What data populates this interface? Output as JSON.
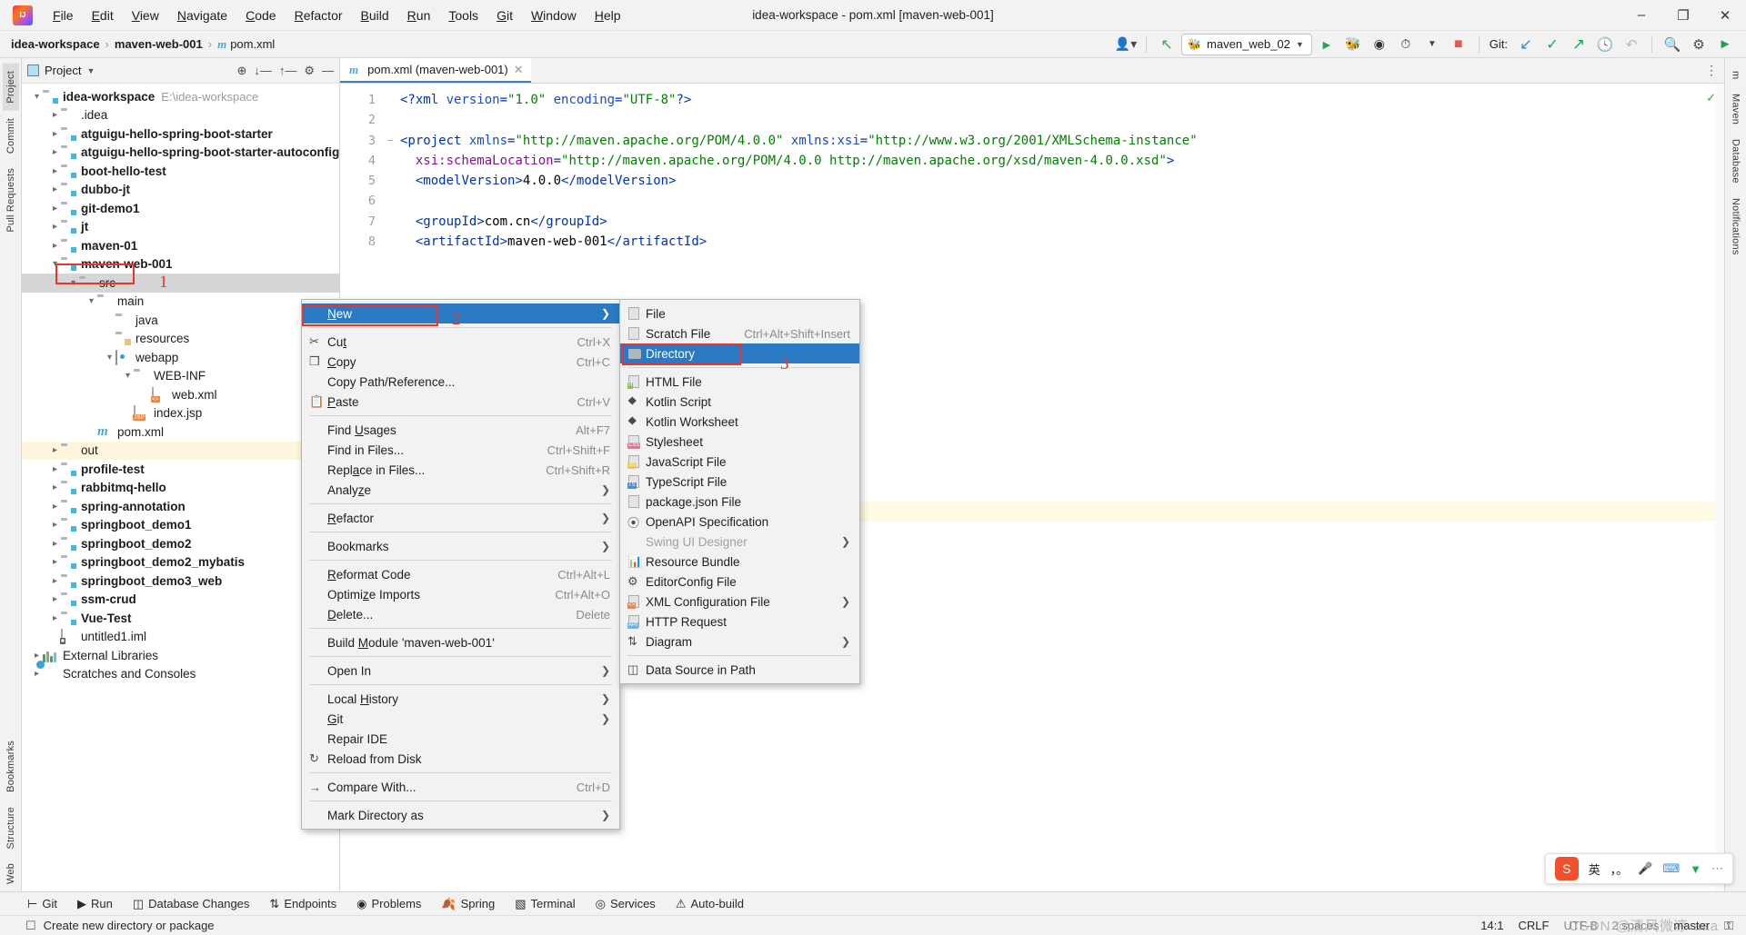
{
  "window": {
    "title": "idea-workspace - pom.xml [maven-web-001]",
    "logo_icon": "intellij-idea-logo",
    "controls": {
      "minimize": "–",
      "maximize": "❐",
      "close": "✕"
    }
  },
  "menubar": [
    {
      "label": "File",
      "mnemonic": "F"
    },
    {
      "label": "Edit",
      "mnemonic": "E"
    },
    {
      "label": "View",
      "mnemonic": "V"
    },
    {
      "label": "Navigate",
      "mnemonic": "N"
    },
    {
      "label": "Code",
      "mnemonic": "C"
    },
    {
      "label": "Refactor",
      "mnemonic": "R"
    },
    {
      "label": "Build",
      "mnemonic": "B"
    },
    {
      "label": "Run",
      "mnemonic": "R"
    },
    {
      "label": "Tools",
      "mnemonic": "T"
    },
    {
      "label": "Git",
      "mnemonic": "G"
    },
    {
      "label": "Window",
      "mnemonic": "W"
    },
    {
      "label": "Help",
      "mnemonic": "H"
    }
  ],
  "navbar": {
    "crumbs": [
      {
        "label": "idea-workspace",
        "bold": true
      },
      {
        "label": "maven-web-001",
        "bold": true
      },
      {
        "label": "pom.xml",
        "bold": false,
        "icon": "maven-m-icon"
      }
    ],
    "separator": "›",
    "run_config": {
      "name": "maven_web_02",
      "icon": "maven-bee-icon",
      "chevron": "▼"
    },
    "buttons": [
      {
        "name": "user-settings-icon",
        "glyph": "▼"
      },
      {
        "name": "build-hammer-icon",
        "glyph": "↖"
      },
      {
        "name": "run-icon",
        "glyph": "▶"
      },
      {
        "name": "debug-icon",
        "glyph": "⚙"
      },
      {
        "name": "run-with-coverage-icon",
        "glyph": "▷"
      },
      {
        "name": "profiler-icon",
        "glyph": "◴"
      },
      {
        "name": "stop-icon",
        "glyph": "■"
      }
    ],
    "git_label": "Git:",
    "git_buttons": [
      {
        "name": "git-update-project-icon",
        "glyph": "↙"
      },
      {
        "name": "git-commit-icon",
        "glyph": "✓"
      },
      {
        "name": "git-push-icon",
        "glyph": "↗"
      },
      {
        "name": "git-history-icon",
        "glyph": "◷"
      },
      {
        "name": "git-rollback-icon",
        "glyph": "↶"
      }
    ],
    "right_buttons": [
      {
        "name": "search-everywhere-icon",
        "glyph": "⚲"
      },
      {
        "name": "settings-gear-icon",
        "glyph": "⚙"
      },
      {
        "name": "ide-assistant-icon",
        "glyph": "▶"
      }
    ]
  },
  "left_strip": [
    {
      "label": "Project",
      "selected": true
    },
    {
      "label": "Commit",
      "selected": false
    },
    {
      "label": "Pull Requests",
      "selected": false
    },
    {
      "label": "Bookmarks",
      "selected": false
    },
    {
      "label": "Structure",
      "selected": false
    },
    {
      "label": "Web",
      "selected": false
    }
  ],
  "right_strip": [
    {
      "label": "m"
    },
    {
      "label": "Maven"
    },
    {
      "label": "Database"
    },
    {
      "label": "Notifications"
    }
  ],
  "project_panel": {
    "title": "Project",
    "chevron": "▼",
    "toolbar_icons": [
      {
        "name": "select-opened-file-icon",
        "glyph": "⊕"
      },
      {
        "name": "expand-all-icon",
        "glyph": "⤓"
      },
      {
        "name": "collapse-all-icon",
        "glyph": "⤒"
      },
      {
        "name": "settings-gear-icon",
        "glyph": "⚙"
      },
      {
        "name": "hide-icon",
        "glyph": "—"
      }
    ],
    "tree": [
      {
        "depth": 0,
        "arrow": "down",
        "icon": "module-folder",
        "label": "idea-workspace",
        "bold": true,
        "path": "E:\\idea-workspace"
      },
      {
        "depth": 1,
        "arrow": "right",
        "icon": "folder",
        "label": ".idea",
        "bold": false
      },
      {
        "depth": 1,
        "arrow": "right",
        "icon": "module-folder",
        "label": "atguigu-hello-spring-boot-starter",
        "bold": true
      },
      {
        "depth": 1,
        "arrow": "right",
        "icon": "module-folder",
        "label": "atguigu-hello-spring-boot-starter-autoconfigu",
        "bold": true
      },
      {
        "depth": 1,
        "arrow": "right",
        "icon": "module-folder",
        "label": "boot-hello-test",
        "bold": true
      },
      {
        "depth": 1,
        "arrow": "right",
        "icon": "module-folder",
        "label": "dubbo-jt",
        "bold": true
      },
      {
        "depth": 1,
        "arrow": "right",
        "icon": "module-folder",
        "label": "git-demo1",
        "bold": true
      },
      {
        "depth": 1,
        "arrow": "right",
        "icon": "module-folder",
        "label": "jt",
        "bold": true
      },
      {
        "depth": 1,
        "arrow": "right",
        "icon": "module-folder",
        "label": "maven-01",
        "bold": true
      },
      {
        "depth": 1,
        "arrow": "down",
        "icon": "module-folder",
        "label": "maven-web-001",
        "bold": true
      },
      {
        "depth": 2,
        "arrow": "down",
        "icon": "folder",
        "label": "src",
        "bold": false,
        "selected": true
      },
      {
        "depth": 3,
        "arrow": "down",
        "icon": "folder",
        "label": "main",
        "bold": false
      },
      {
        "depth": 4,
        "arrow": "none",
        "icon": "source-folder",
        "label": "java",
        "bold": false
      },
      {
        "depth": 4,
        "arrow": "none",
        "icon": "resource-folder",
        "label": "resources",
        "bold": false
      },
      {
        "depth": 4,
        "arrow": "down",
        "icon": "web-folder",
        "label": "webapp",
        "bold": false
      },
      {
        "depth": 5,
        "arrow": "down",
        "icon": "folder",
        "label": "WEB-INF",
        "bold": false
      },
      {
        "depth": 6,
        "arrow": "none",
        "icon": "xml-file",
        "label": "web.xml",
        "bold": false
      },
      {
        "depth": 5,
        "arrow": "none",
        "icon": "jsp-file",
        "label": "index.jsp",
        "bold": false
      },
      {
        "depth": 3,
        "arrow": "none",
        "icon": "maven-file",
        "label": "pom.xml",
        "bold": false
      },
      {
        "depth": 1,
        "arrow": "right",
        "icon": "out-folder",
        "label": "out",
        "bold": false,
        "highlight": true
      },
      {
        "depth": 1,
        "arrow": "right",
        "icon": "module-folder",
        "label": "profile-test",
        "bold": true
      },
      {
        "depth": 1,
        "arrow": "right",
        "icon": "module-folder",
        "label": "rabbitmq-hello",
        "bold": true
      },
      {
        "depth": 1,
        "arrow": "right",
        "icon": "module-folder",
        "label": "spring-annotation",
        "bold": true
      },
      {
        "depth": 1,
        "arrow": "right",
        "icon": "module-folder",
        "label": "springboot_demo1",
        "bold": true
      },
      {
        "depth": 1,
        "arrow": "right",
        "icon": "module-folder",
        "label": "springboot_demo2",
        "bold": true
      },
      {
        "depth": 1,
        "arrow": "right",
        "icon": "module-folder",
        "label": "springboot_demo2_mybatis",
        "bold": true
      },
      {
        "depth": 1,
        "arrow": "right",
        "icon": "module-folder",
        "label": "springboot_demo3_web",
        "bold": true
      },
      {
        "depth": 1,
        "arrow": "right",
        "icon": "module-folder",
        "label": "ssm-crud",
        "bold": true
      },
      {
        "depth": 1,
        "arrow": "right",
        "icon": "module-folder",
        "label": "Vue-Test",
        "bold": true
      },
      {
        "depth": 1,
        "arrow": "none",
        "icon": "iml-file",
        "label": "untitled1.iml",
        "bold": false
      },
      {
        "depth": 0,
        "arrow": "right",
        "icon": "libraries",
        "label": "External Libraries",
        "bold": false
      },
      {
        "depth": 0,
        "arrow": "right",
        "icon": "scratches",
        "label": "Scratches and Consoles",
        "bold": false
      }
    ]
  },
  "editor": {
    "tab": {
      "label": "pom.xml (maven-web-001)",
      "icon": "maven-m-icon",
      "close": "✕"
    },
    "more_icon": "⋮",
    "inspection_status": "✓",
    "lines": [
      {
        "n": 1,
        "fold": "",
        "html": "<span class=\"cx-tag\">&lt;?xml </span><span class=\"cx-attr\">version</span><span class=\"cx-tag\">=</span><span class=\"cx-val\">\"1.0\"</span><span class=\"cx-attr\"> encoding</span><span class=\"cx-tag\">=</span><span class=\"cx-val\">\"UTF-8\"</span><span class=\"cx-tag\">?&gt;</span>"
      },
      {
        "n": 2,
        "fold": "",
        "html": ""
      },
      {
        "n": 3,
        "fold": "−",
        "html": "<span class=\"cx-tag\">&lt;project </span><span class=\"cx-attr\">xmlns</span><span class=\"cx-tag\">=</span><span class=\"cx-val\">\"http://maven.apache.org/POM/4.0.0\"</span><span class=\"cx-attr\"> xmlns:xsi</span><span class=\"cx-tag\">=</span><span class=\"cx-val\">\"http://www.w3.org/2001/XMLSchema-instance\"</span>"
      },
      {
        "n": 4,
        "fold": "",
        "html": "  <span class=\"cx-ns\">xsi:schemaLocation</span><span class=\"cx-tag\">=</span><span class=\"cx-val\">\"http://maven.apache.org/POM/4.0.0 http://maven.apache.org/xsd/maven-4.0.0.xsd\"</span><span class=\"cx-tag\">&gt;</span>"
      },
      {
        "n": 5,
        "fold": "",
        "html": "  <span class=\"cx-tag\">&lt;</span><span class=\"cx-name\">modelVersion</span><span class=\"cx-tag\">&gt;</span><span class=\"cx-txt\">4.0.0</span><span class=\"cx-tag\">&lt;/</span><span class=\"cx-name\">modelVersion</span><span class=\"cx-tag\">&gt;</span>"
      },
      {
        "n": 6,
        "fold": "",
        "html": ""
      },
      {
        "n": 7,
        "fold": "",
        "html": "  <span class=\"cx-tag\">&lt;</span><span class=\"cx-name\">groupId</span><span class=\"cx-tag\">&gt;</span><span class=\"cx-txt\">com.cn</span><span class=\"cx-tag\">&lt;/</span><span class=\"cx-name\">groupId</span><span class=\"cx-tag\">&gt;</span>"
      },
      {
        "n": 8,
        "fold": "",
        "html": "  <span class=\"cx-tag\">&lt;</span><span class=\"cx-name\">artifactId</span><span class=\"cx-tag\">&gt;</span><span class=\"cx-txt\">maven-web-001</span><span class=\"cx-tag\">&lt;/</span><span class=\"cx-name\">artifactId</span><span class=\"cx-tag\">&gt;</span>"
      }
    ]
  },
  "context_menu": {
    "items": [
      {
        "label": "New",
        "mnem": "N",
        "selected": true,
        "submenu": true,
        "annotated": true
      },
      {
        "sep": true
      },
      {
        "label": "Cut",
        "mnem": "t",
        "shortcut": "Ctrl+X",
        "icon": "scissors-icon"
      },
      {
        "label": "Copy",
        "mnem": "C",
        "shortcut": "Ctrl+C",
        "icon": "copy-icon"
      },
      {
        "label": "Copy Path/Reference...",
        "shortcut": ""
      },
      {
        "label": "Paste",
        "mnem": "P",
        "shortcut": "Ctrl+V",
        "icon": "paste-icon"
      },
      {
        "sep": true
      },
      {
        "label": "Find Usages",
        "mnem": "U",
        "shortcut": "Alt+F7"
      },
      {
        "label": "Find in Files...",
        "shortcut": "Ctrl+Shift+F"
      },
      {
        "label": "Replace in Files...",
        "mnem": "a",
        "shortcut": "Ctrl+Shift+R"
      },
      {
        "label": "Analyze",
        "mnem": "z",
        "submenu": true
      },
      {
        "sep": true
      },
      {
        "label": "Refactor",
        "mnem": "R",
        "submenu": true
      },
      {
        "sep": true
      },
      {
        "label": "Bookmarks",
        "submenu": true
      },
      {
        "sep": true
      },
      {
        "label": "Reformat Code",
        "mnem": "R",
        "shortcut": "Ctrl+Alt+L"
      },
      {
        "label": "Optimize Imports",
        "mnem": "z",
        "shortcut": "Ctrl+Alt+O"
      },
      {
        "label": "Delete...",
        "mnem": "D",
        "shortcut": "Delete"
      },
      {
        "sep": true
      },
      {
        "label": "Build Module 'maven-web-001'",
        "mnem": "M"
      },
      {
        "sep": true
      },
      {
        "label": "Open In",
        "submenu": true
      },
      {
        "sep": true
      },
      {
        "label": "Local History",
        "mnem": "H",
        "submenu": true
      },
      {
        "label": "Git",
        "mnem": "G",
        "submenu": true
      },
      {
        "label": "Repair IDE"
      },
      {
        "label": "Reload from Disk",
        "icon": "reload-icon"
      },
      {
        "sep": true
      },
      {
        "label": "Compare With...",
        "shortcut": "Ctrl+D",
        "icon": "compare-icon"
      },
      {
        "sep": true
      },
      {
        "label": "Mark Directory as",
        "submenu": true
      }
    ]
  },
  "new_submenu": {
    "items": [
      {
        "label": "File",
        "icon": "file-icon"
      },
      {
        "label": "Scratch File",
        "shortcut": "Ctrl+Alt+Shift+Insert",
        "icon": "scratch-file-icon"
      },
      {
        "label": "Directory",
        "icon": "folder-icon",
        "selected": true,
        "annotated": true
      },
      {
        "sep": true
      },
      {
        "label": "HTML File",
        "icon": "html-file-icon",
        "badge": "H",
        "badge_color": "#8bc34a"
      },
      {
        "label": "Kotlin Script",
        "icon": "kotlin-script-icon"
      },
      {
        "label": "Kotlin Worksheet",
        "icon": "kotlin-worksheet-icon"
      },
      {
        "label": "Stylesheet",
        "icon": "css-file-icon",
        "badge": "CSS",
        "badge_color": "#e8738f"
      },
      {
        "label": "JavaScript File",
        "icon": "js-file-icon",
        "badge": "JS",
        "badge_color": "#efc84a"
      },
      {
        "label": "TypeScript File",
        "icon": "ts-file-icon",
        "badge": "TS",
        "badge_color": "#4a8fd6"
      },
      {
        "label": "package.json File",
        "icon": "nodejs-icon"
      },
      {
        "label": "OpenAPI Specification",
        "icon": "openapi-icon"
      },
      {
        "label": "Swing UI Designer",
        "submenu": true,
        "disabled": true
      },
      {
        "label": "Resource Bundle",
        "icon": "resource-bundle-icon"
      },
      {
        "label": "EditorConfig File",
        "icon": "gear-icon"
      },
      {
        "label": "XML Configuration File",
        "icon": "xml-file-icon",
        "badge": "<>",
        "badge_color": "#e8874a",
        "submenu": true
      },
      {
        "label": "HTTP Request",
        "icon": "http-request-icon",
        "badge": "API",
        "badge_color": "#6ab7e8"
      },
      {
        "label": "Diagram",
        "icon": "diagram-icon",
        "submenu": true
      },
      {
        "sep": true
      },
      {
        "label": "Data Source in Path",
        "icon": "data-source-icon"
      }
    ]
  },
  "annotations": [
    {
      "number": "1",
      "target": "src-tree-node"
    },
    {
      "number": "2",
      "target": "new-menu-item"
    },
    {
      "number": "3",
      "target": "directory-submenu-item"
    }
  ],
  "tool_window_bar": {
    "items": [
      {
        "label": "Git",
        "icon": "git-branch-icon"
      },
      {
        "label": "Run",
        "icon": "run-icon"
      },
      {
        "label": "Database Changes",
        "icon": "database-icon"
      },
      {
        "label": "Endpoints",
        "icon": "endpoints-icon"
      },
      {
        "label": "Problems",
        "icon": "problems-icon"
      },
      {
        "label": "Spring",
        "icon": "spring-leaf-icon"
      },
      {
        "label": "Terminal",
        "icon": "terminal-icon"
      },
      {
        "label": "Services",
        "icon": "services-icon"
      },
      {
        "label": "Auto-build",
        "icon": "warning-icon"
      }
    ]
  },
  "status_bar": {
    "message": "Create new directory or package",
    "message_icon": "tip-icon",
    "caret_position": "14:1",
    "line_separator": "CRLF",
    "encoding": "UTF-8",
    "indent": "2 spaces",
    "branch": "master",
    "lock_icon": "⚿"
  },
  "ime_tray": {
    "app_icon": "sogou-icon",
    "mode": "英",
    "items": [
      {
        "name": "punctuation-icon",
        "glyph": "，。"
      },
      {
        "name": "microphone-icon",
        "glyph": "Ἲ4"
      },
      {
        "name": "keyboard-icon",
        "glyph": "⌨"
      },
      {
        "name": "toolbox-icon",
        "glyph": "▼"
      },
      {
        "name": "more-icon",
        "glyph": "⋯"
      }
    ]
  },
  "watermark": "CSDN @清风微凉 aaa"
}
